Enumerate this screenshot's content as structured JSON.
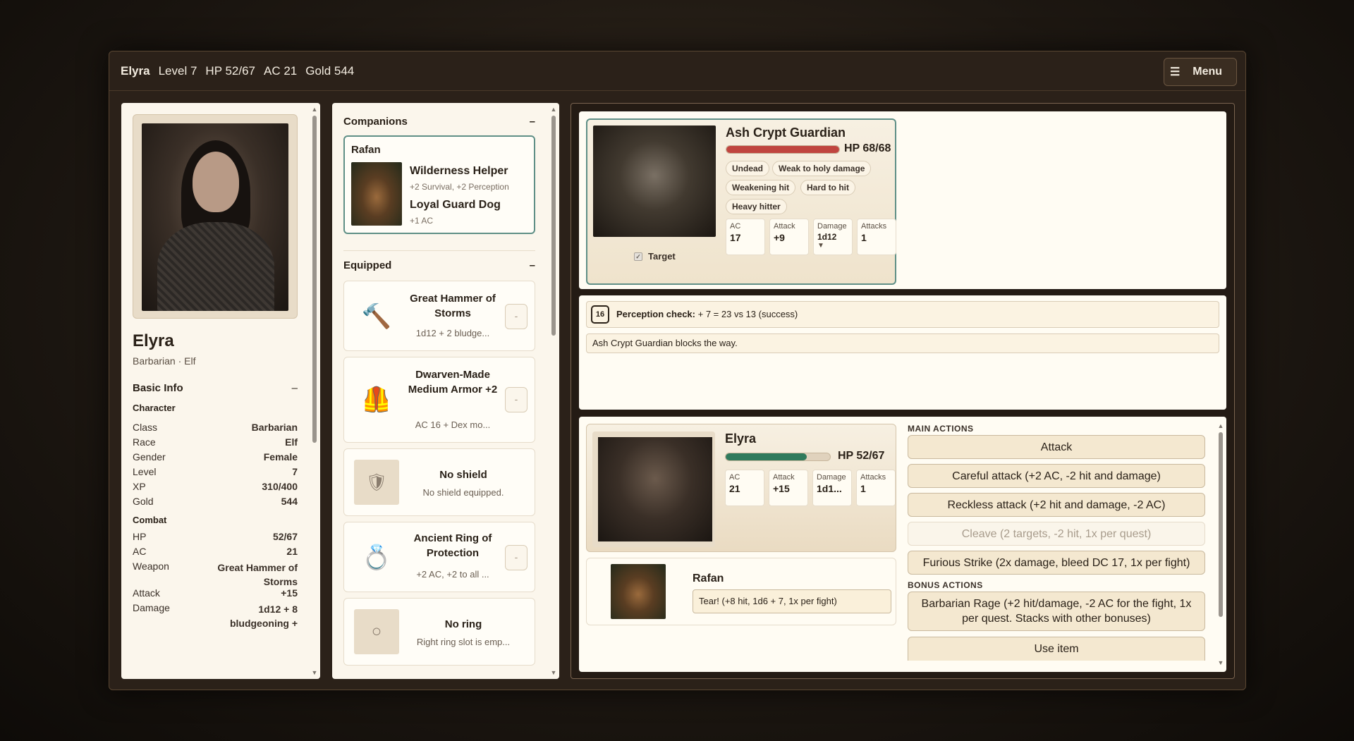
{
  "topbar": {
    "name": "Elyra",
    "level": "Level 7",
    "hp": "HP 52/67",
    "ac": "AC 21",
    "gold": "Gold 544",
    "menu_icon": "☰",
    "menu_label": "Menu"
  },
  "character": {
    "name": "Elyra",
    "subtitle": "Barbarian · Elf",
    "basic_info_label": "Basic Info",
    "toggle": "–",
    "group_character": "Character",
    "class_label": "Class",
    "class": "Barbarian",
    "race_label": "Race",
    "race": "Elf",
    "gender_label": "Gender",
    "gender": "Female",
    "level_label": "Level",
    "level": "7",
    "xp_label": "XP",
    "xp": "310/400",
    "gold_label": "Gold",
    "gold": "544",
    "group_combat": "Combat",
    "hp_label": "HP",
    "hp": "52/67",
    "ac_label": "AC",
    "ac": "21",
    "weapon_label": "Weapon",
    "weapon": "Great Hammer of Storms",
    "attack_label": "Attack",
    "attack": "+15",
    "damage_label": "Damage",
    "damage": "1d12 + 8 bludgeoning +"
  },
  "companions": {
    "header": "Companions",
    "toggle": "–",
    "name": "Rafan",
    "trait1": "Wilderness Helper",
    "trait1_desc": "+2 Survival, +2 Perception",
    "trait2": "Loyal Guard Dog",
    "trait2_desc": "+1 AC"
  },
  "equipped": {
    "header": "Equipped",
    "toggle": "–",
    "items": [
      {
        "name": "Great Hammer of Storms",
        "desc": "1d12 + 2 bludge...",
        "btn": "-",
        "icon": "🔨"
      },
      {
        "name": "Dwarven-Made Medium Armor +2",
        "desc": "AC 16 + Dex mo...",
        "btn": "-",
        "icon": "🦺"
      },
      {
        "name": "No shield",
        "desc": "No shield equipped.",
        "icon": "🛡"
      },
      {
        "name": "Ancient Ring of Protection",
        "desc": "+2 AC, +2 to all ...",
        "btn": "-",
        "icon": "💍"
      },
      {
        "name": "No ring",
        "desc": "Right ring slot is emp...",
        "icon": "○"
      }
    ]
  },
  "enemy": {
    "name": "Ash Crypt Guardian",
    "hp_text": "HP 68/68",
    "hp_fraction": 1.0,
    "tags": [
      "Undead",
      "Weak to holy damage",
      "Weakening hit",
      "Hard to hit",
      "Heavy hitter"
    ],
    "ac_label": "AC",
    "ac": "17",
    "attack_label": "Attack",
    "attack": "+9",
    "damage_label": "Damage",
    "damage": "1d12",
    "damage_more": "▼",
    "attacks_label": "Attacks",
    "attacks": "1",
    "target_label": "Target",
    "target_check": "✓"
  },
  "log": {
    "die": "16",
    "check_label": "Perception check:",
    "check_text": "+ 7 = 23 vs 13 (success)",
    "line2": "Ash Crypt Guardian blocks the way."
  },
  "player": {
    "name": "Elyra",
    "hp_text": "HP 52/67",
    "hp_fraction": 0.776,
    "ac_label": "AC",
    "ac": "21",
    "attack_label": "Attack",
    "attack": "+15",
    "damage_label": "Damage",
    "damage": "1d1...",
    "attacks_label": "Attacks",
    "attacks": "1"
  },
  "ally": {
    "name": "Rafan",
    "action": "Tear! (+8 hit, 1d6 + 7, 1x per fight)"
  },
  "actions": {
    "main_header": "MAIN ACTIONS",
    "attack": "Attack",
    "careful": "Careful attack (+2 AC, -2 hit and damage)",
    "reckless": "Reckless attack (+2 hit and damage, -2 AC)",
    "cleave": "Cleave (2 targets, -2 hit, 1x per quest)",
    "furious": "Furious Strike (2x damage, bleed DC 17, 1x per fight)",
    "bonus_header": "BONUS ACTIONS",
    "rage": "Barbarian Rage (+2 hit/damage, -2 AC for the fight, 1x per quest. Stacks with other bonuses)",
    "use_item": "Use item"
  },
  "colors": {
    "enemy_hp": "#c0453f",
    "player_hp": "#2f7a5c",
    "accent": "#5f8f86"
  }
}
